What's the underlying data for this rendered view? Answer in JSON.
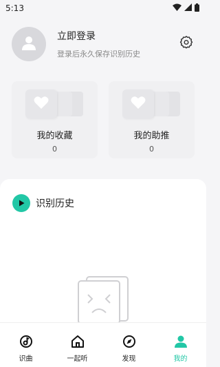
{
  "status_bar": {
    "time": "5:13"
  },
  "profile": {
    "title": "立即登录",
    "subtitle": "登录后永久保存识别历史",
    "avatar_icon": "user-icon",
    "settings_icon": "gear-icon"
  },
  "cards": [
    {
      "label": "我的收藏",
      "count": "0",
      "icon": "heart-icon"
    },
    {
      "label": "我的助推",
      "count": "0",
      "icon": "heart-icon"
    }
  ],
  "history": {
    "title": "识别历史",
    "icon": "play-icon",
    "empty_icon": "sad-face-icon"
  },
  "nav": {
    "items": [
      {
        "label": "识曲",
        "icon": "music-note-icon",
        "active": false
      },
      {
        "label": "一起听",
        "icon": "home-icon",
        "active": false
      },
      {
        "label": "发现",
        "icon": "compass-icon",
        "active": false
      },
      {
        "label": "我的",
        "icon": "user-icon",
        "active": true
      }
    ]
  },
  "colors": {
    "accent": "#22c7a6",
    "background": "#f5f5f7",
    "card": "#f0f0f2"
  }
}
